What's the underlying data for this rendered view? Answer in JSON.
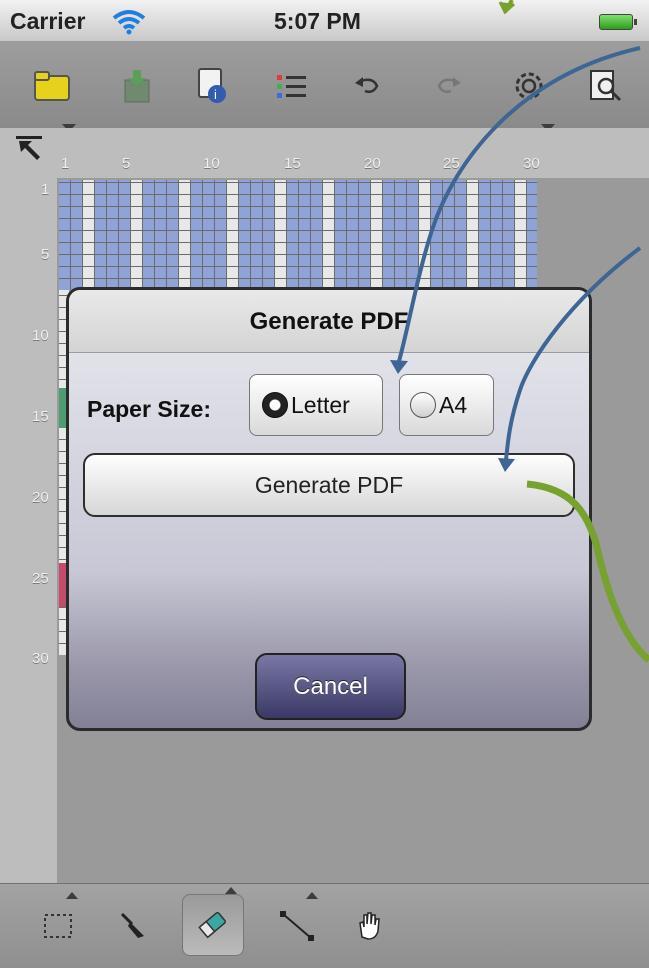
{
  "status_bar": {
    "carrier": "Carrier",
    "time": "5:07 PM"
  },
  "toolbar": {
    "icons": [
      "folder-icon",
      "save-icon",
      "info-document-icon",
      "list-icon",
      "undo-icon",
      "redo-icon",
      "settings-icon",
      "preview-icon"
    ]
  },
  "ruler": {
    "columns": [
      "1",
      "5",
      "10",
      "15",
      "20",
      "25",
      "30"
    ],
    "rows": [
      "1",
      "5",
      "10",
      "15",
      "20",
      "25",
      "30"
    ]
  },
  "dialog": {
    "title": "Generate PDF",
    "paper_size_label": "Paper Size:",
    "options": [
      {
        "label": "Letter",
        "selected": true
      },
      {
        "label": "A4",
        "selected": false
      }
    ],
    "generate_button": "Generate PDF",
    "cancel_button": "Cancel"
  },
  "bottom_toolbar": {
    "tools": [
      "selection-tool-icon",
      "eyedropper-icon",
      "eraser-icon",
      "line-tool-icon",
      "hand-icon"
    ],
    "selected_tool": "eraser-icon"
  },
  "colors": {
    "grid_blue": "#8fa3d6",
    "cancel_button": "#4a4878",
    "annotation_blue": "#3e6594",
    "annotation_green": "#77a22f"
  }
}
